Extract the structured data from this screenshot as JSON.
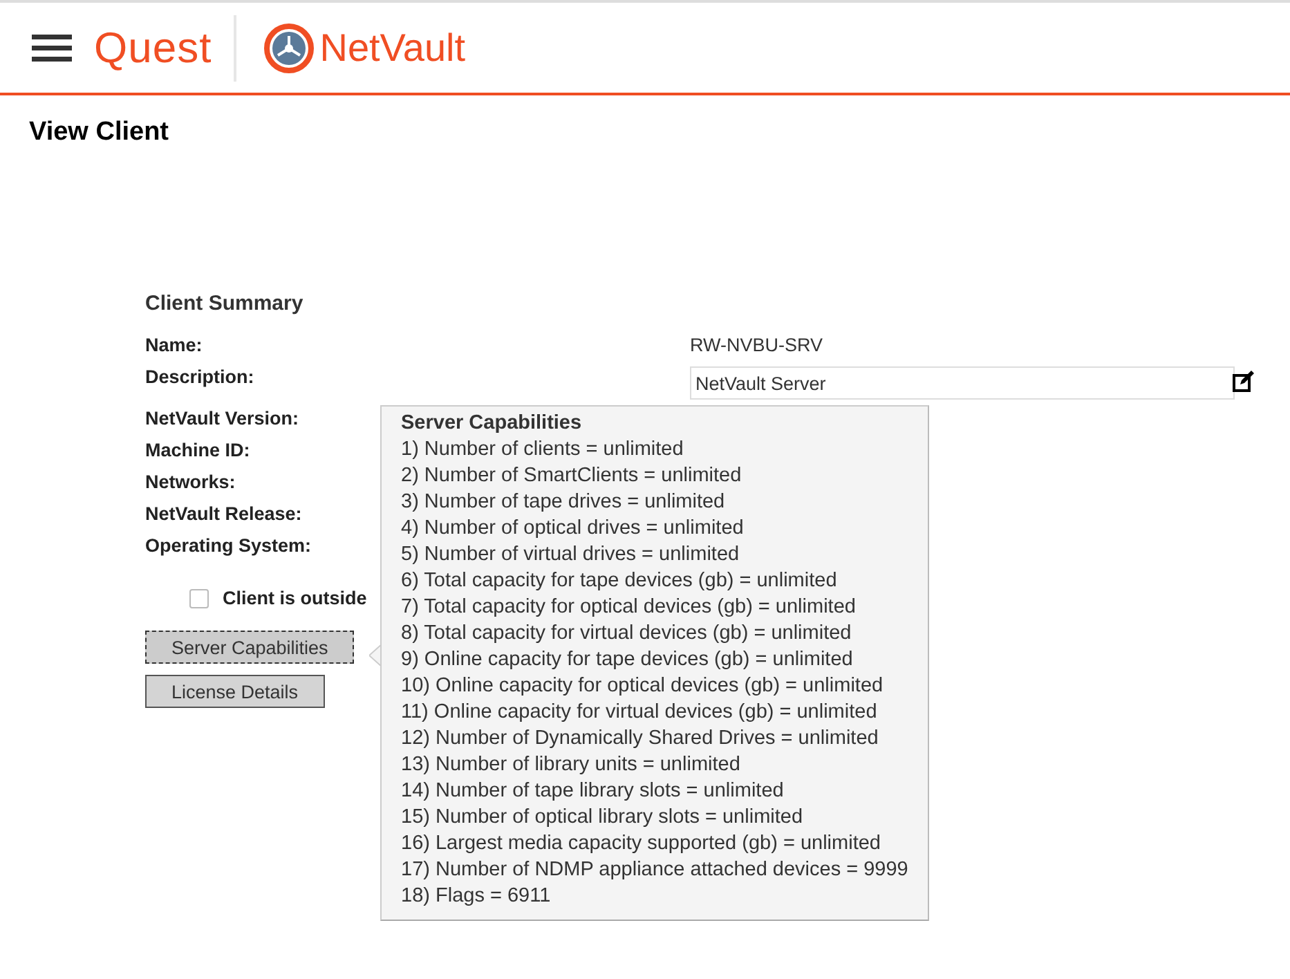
{
  "header": {
    "menu_icon": true,
    "brand": "Quest",
    "product": "NetVault"
  },
  "page_title": "View Client",
  "summary": {
    "title": "Client Summary",
    "fields": [
      {
        "label": "Name:",
        "kind": "text",
        "value": "RW-NVBU-SRV"
      },
      {
        "label": "Description:",
        "kind": "input",
        "value": "NetVault Server"
      },
      {
        "label": "NetVault Version:",
        "kind": "text"
      },
      {
        "label": "Machine ID:",
        "kind": "text"
      },
      {
        "label": "Networks:",
        "kind": "text"
      },
      {
        "label": "NetVault Release:",
        "kind": "text"
      },
      {
        "label": "Operating System:",
        "kind": "text"
      }
    ],
    "checkbox": {
      "label": "Client is outside",
      "checked": false
    },
    "buttons": [
      {
        "label": "Server Capabilities",
        "selected": true
      },
      {
        "label": "License Details",
        "selected": false
      }
    ]
  },
  "tooltip": {
    "title": "Server Capabilities",
    "lines": [
      "1) Number of clients = unlimited",
      "2) Number of SmartClients = unlimited",
      "3) Number of tape drives = unlimited",
      "4) Number of optical drives = unlimited",
      "5) Number of virtual drives = unlimited",
      "6) Total capacity for tape devices (gb) = unlimited",
      "7) Total capacity for optical devices (gb) = unlimited",
      "8) Total capacity for virtual devices (gb) = unlimited",
      "9) Online capacity for tape devices (gb) = unlimited",
      "10) Online capacity for optical devices (gb) = unlimited",
      "11) Online capacity for virtual devices (gb) = unlimited",
      "12) Number of Dynamically Shared Drives = unlimited",
      "13) Number of library units = unlimited",
      "14) Number of tape library slots = unlimited",
      "15) Number of optical library slots = unlimited",
      "16) Largest media capacity supported (gb) = unlimited",
      "17) Number of NDMP appliance attached devices = 9999",
      "18) Flags = 6911"
    ]
  }
}
